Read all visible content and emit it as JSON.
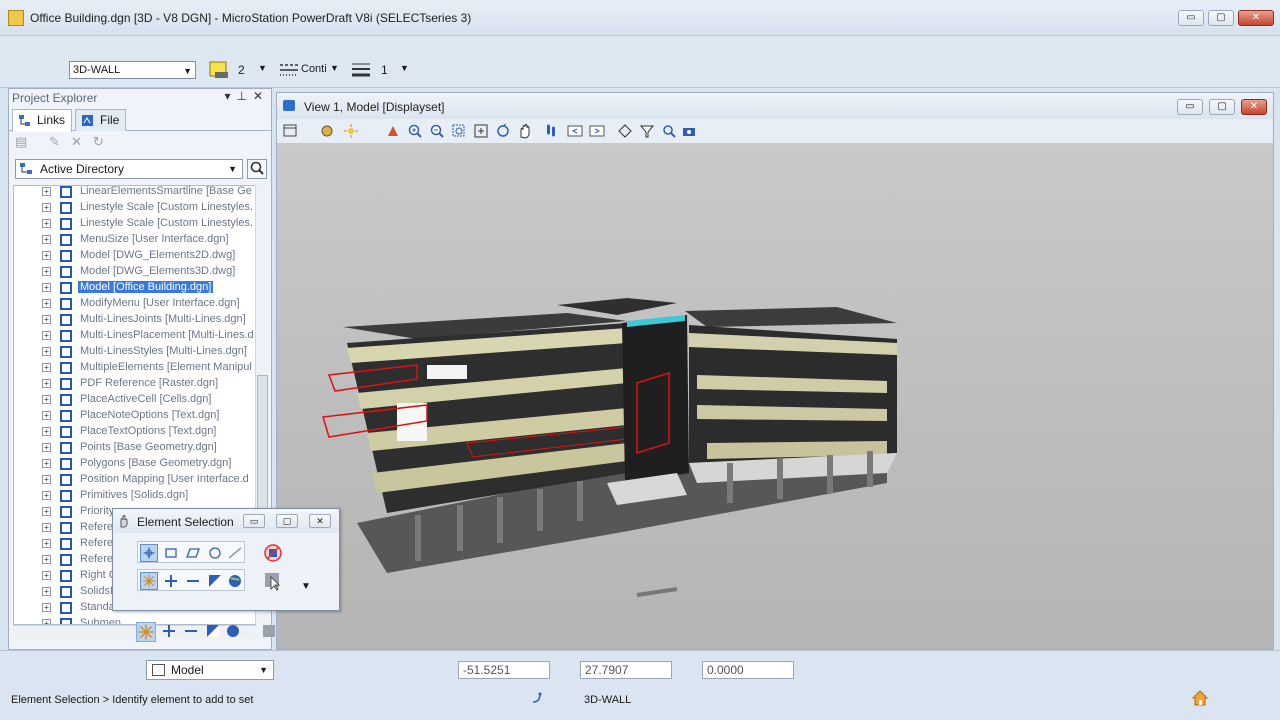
{
  "window": {
    "title": "Office Building.dgn [3D - V8 DGN] - MicroStation PowerDraft V8i (SELECTseries 3)",
    "minimize": "▭",
    "maximize": "▢",
    "close": "✕"
  },
  "attributes": {
    "level": "3D-WALL",
    "color": "2",
    "line_style": "Conti",
    "line_weight": "1"
  },
  "project_explorer": {
    "title": "Project Explorer",
    "tabs": [
      "Links",
      "File"
    ],
    "directory": "Active Directory",
    "items": [
      {
        "name": "LinearElementsSmartline",
        "file": "[Base Ge"
      },
      {
        "name": "Linestyle Scale",
        "file": "[Custom Linestyles."
      },
      {
        "name": "Linestyle Scale",
        "file": "[Custom Linestyles."
      },
      {
        "name": "MenuSize",
        "file": "[User Interface.dgn]"
      },
      {
        "name": "Model",
        "file": "[DWG_Elements2D.dwg]"
      },
      {
        "name": "Model",
        "file": "[DWG_Elements3D.dwg]"
      },
      {
        "name": "Model",
        "file": "[Office Building.dgn]"
      },
      {
        "name": "ModifyMenu",
        "file": "[User Interface.dgn]"
      },
      {
        "name": "Multi-LinesJoints",
        "file": "[Multi-Lines.dgn]"
      },
      {
        "name": "Multi-LinesPlacement",
        "file": "[Multi-Lines.d"
      },
      {
        "name": "Multi-LinesStyles",
        "file": "[Multi-Lines.dgn]"
      },
      {
        "name": "MultipleElements",
        "file": "[Element Manipul"
      },
      {
        "name": "PDF Reference",
        "file": "[Raster.dgn]"
      },
      {
        "name": "PlaceActiveCell",
        "file": "[Cells.dgn]"
      },
      {
        "name": "PlaceNoteOptions",
        "file": "[Text.dgn]"
      },
      {
        "name": "PlaceTextOptions",
        "file": "[Text.dgn]"
      },
      {
        "name": "Points",
        "file": "[Base Geometry.dgn]"
      },
      {
        "name": "Polygons",
        "file": "[Base Geometry.dgn]"
      },
      {
        "name": "Position Mapping",
        "file": "[User Interface.d"
      },
      {
        "name": "Primitives",
        "file": "[Solids.dgn]"
      },
      {
        "name": "Priority",
        "file": ""
      },
      {
        "name": "Referen",
        "file": ""
      },
      {
        "name": "Referen",
        "file": ""
      },
      {
        "name": "Referen",
        "file": ""
      },
      {
        "name": "Right C",
        "file": ""
      },
      {
        "name": "SolidsM",
        "file": ""
      },
      {
        "name": "Standa",
        "file": ""
      },
      {
        "name": "Submen",
        "file": ""
      }
    ],
    "selected_index": 6
  },
  "view": {
    "title": "View 1, Model [Displayset]"
  },
  "element_selection": {
    "title": "Element Selection"
  },
  "bottom": {
    "model": "Model",
    "x": "-51.5251",
    "y": "27.7907",
    "z": "0.0000",
    "status_message": "Element Selection > Identify element to add to set",
    "active_level": "3D-WALL"
  },
  "colors": {
    "accent": "#3a78e0",
    "icon_blue": "#1e5bc6",
    "canvas": "#c4c4c4"
  }
}
